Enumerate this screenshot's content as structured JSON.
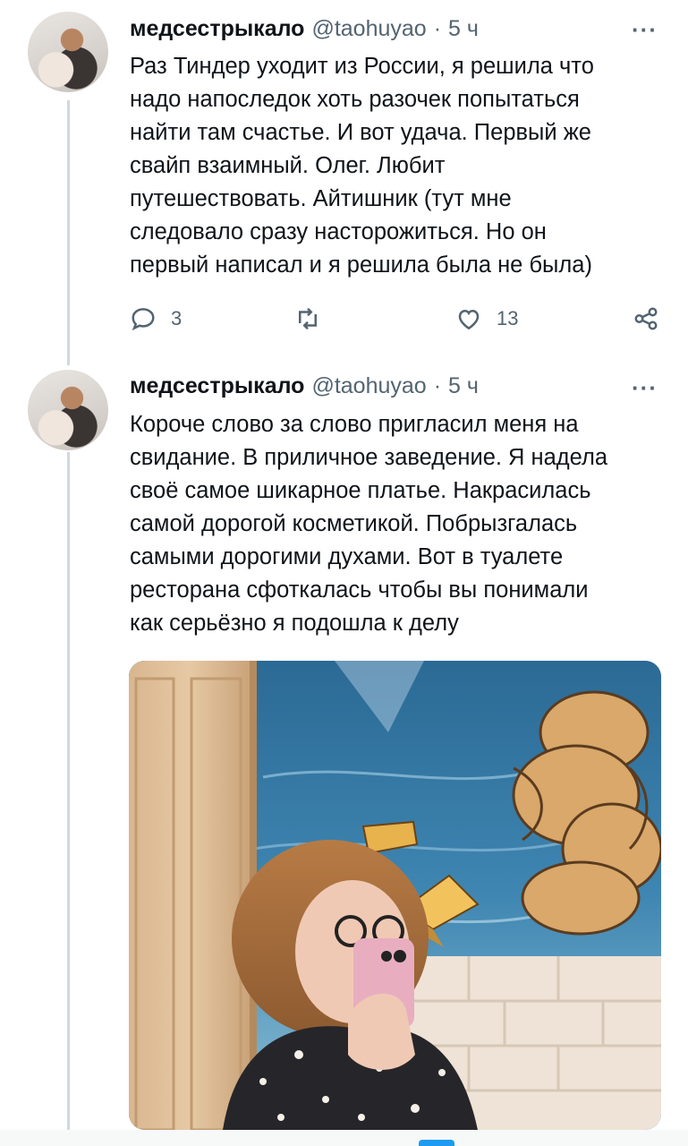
{
  "tweets": [
    {
      "name": "медсестрыкало",
      "handle": "@taohuyao",
      "separator": "·",
      "time": "5 ч",
      "more": "···",
      "text": "Раз Тиндер уходит из России, я решила что\nнадо напоследок хоть разочек попытаться\nнайти там счастье. И вот удача. Первый же\nсвайп взаимный. Олег. Любит\nпутешествовать. Айтишник (тут мне\nследовало сразу насторожиться. Но он\nпервый написал и я решила была не была)",
      "actions": {
        "reply_icon": "reply-icon",
        "reply_count": "3",
        "retweet_icon": "retweet-icon",
        "like_icon": "heart-icon",
        "like_count": "13",
        "share_icon": "share-icon"
      }
    },
    {
      "name": "медсестрыкало",
      "handle": "@taohuyao",
      "separator": "·",
      "time": "5 ч",
      "more": "···",
      "text": "Короче слово за слово пригласил меня на\nсвидание. В приличное заведение. Я надела\nсвоё самое шикарное платье. Накрасилась\nсамой дорогой косметикой. Побрызгалась\nсамыми дорогими духами. Вот в туалете\nресторана сфоткалась чтобы вы понимали\nкак серьёзно я подошла к делу"
    }
  ],
  "colors": {
    "text": "#0f1419",
    "secondary": "#536471",
    "thread_line": "#cfd9de",
    "accent": "#1d9bf0"
  }
}
